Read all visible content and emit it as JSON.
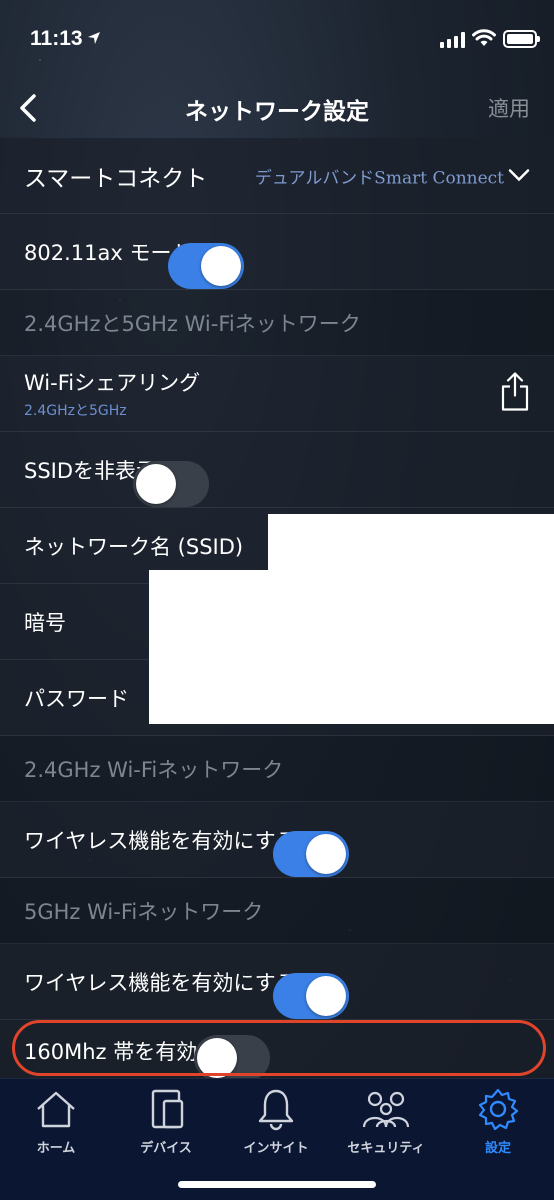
{
  "status_bar": {
    "time": "11:13"
  },
  "header": {
    "title": "ネットワーク設定",
    "apply_label": "適用"
  },
  "rows": {
    "smart_connect": {
      "label": "スマートコネクト",
      "value": "デュアルバンドSmart Connect"
    },
    "ax_mode": {
      "label": "802.11ax モード",
      "enabled": true
    },
    "section_dual": "2.4GHzと5GHz Wi-Fiネットワーク",
    "wifi_sharing": {
      "label": "Wi-Fiシェアリング",
      "sub": "2.4GHzと5GHz"
    },
    "hide_ssid": {
      "label": "SSIDを非表示",
      "enabled": false
    },
    "network_name": {
      "label": "ネットワーク名 (SSID)"
    },
    "encryption": {
      "label": "暗号"
    },
    "password": {
      "label": "パスワード"
    },
    "section_24": "2.4GHz Wi-Fiネットワーク",
    "wireless_24": {
      "label": "ワイヤレス機能を有効にする",
      "enabled": true
    },
    "section_5": "5GHz Wi-Fiネットワーク",
    "wireless_5": {
      "label": "ワイヤレス機能を有効にする",
      "enabled": true
    },
    "band_160": {
      "label": "160Mhz 帯を有効化",
      "enabled": false
    }
  },
  "tabbar": {
    "items": [
      {
        "label": "ホーム",
        "icon": "home-icon"
      },
      {
        "label": "デバイス",
        "icon": "devices-icon"
      },
      {
        "label": "インサイト",
        "icon": "bell-icon"
      },
      {
        "label": "セキュリティ",
        "icon": "family-icon"
      },
      {
        "label": "設定",
        "icon": "gear-icon",
        "active": true
      }
    ]
  },
  "colors": {
    "accent": "#3a80e6",
    "tab_active": "#2f8bff",
    "highlight": "#e0452c"
  }
}
